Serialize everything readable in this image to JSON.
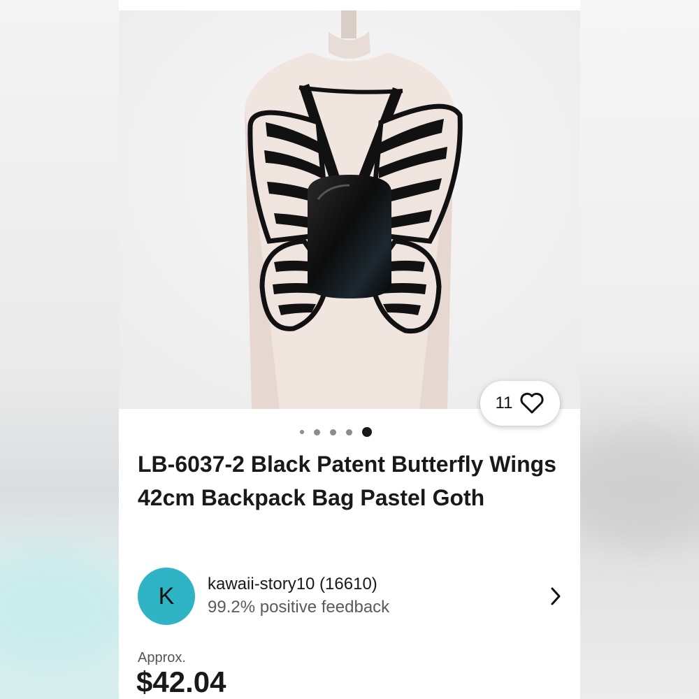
{
  "listing": {
    "like_count": "11",
    "image_count": 5,
    "active_image": 5,
    "title": "LB-6037-2 Black Patent Butterfly Wings 42cm Backpack Bag Pastel Goth",
    "seller": {
      "avatar_initial": "K",
      "avatar_color": "#2fb4c6",
      "name": "kawaii-story10 (16610)",
      "feedback": "99.2% positive feedback"
    },
    "price_prefix": "Approx.",
    "price": "$42.04"
  },
  "icons": {
    "like": "heart-icon",
    "seller_link": "chevron-right-icon"
  }
}
